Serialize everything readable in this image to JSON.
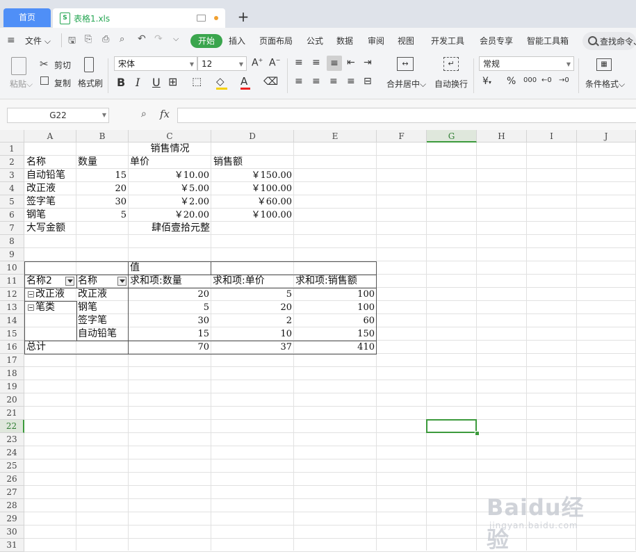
{
  "tabs": {
    "home": "首页",
    "file": "表格1.xls",
    "add": "+"
  },
  "menu": {
    "file": "文件",
    "items": [
      "开始",
      "插入",
      "页面布局",
      "公式",
      "数据",
      "审阅",
      "视图",
      "开发工具",
      "会员专享",
      "智能工具箱"
    ],
    "search_placeholder": "查找命令、"
  },
  "ribbon": {
    "paste": "粘贴",
    "cut": "剪切",
    "copy": "复制",
    "format_painter": "格式刷",
    "font_name": "宋体",
    "font_size": "12",
    "merge_center": "合并居中",
    "wrap_text": "自动换行",
    "number_format": "常规",
    "conditional_format": "条件格式",
    "currency_symbol": "¥",
    "percent_symbol": "%",
    "thousands": "000"
  },
  "formula_bar": {
    "cell_ref": "G22",
    "fx": "fx",
    "value": ""
  },
  "columns": [
    "A",
    "B",
    "C",
    "D",
    "E",
    "F",
    "G",
    "H",
    "I",
    "J"
  ],
  "selected_column": "G",
  "selected_row": 22,
  "rows": [
    1,
    2,
    3,
    4,
    5,
    6,
    7,
    8,
    9,
    10,
    11,
    12,
    13,
    14,
    15,
    16,
    17,
    18,
    19,
    20,
    21,
    22,
    23,
    24,
    25,
    26,
    27,
    28,
    29,
    30,
    31
  ],
  "sheet": {
    "title": "销售情况",
    "headers": [
      "名称",
      "数量",
      "单价",
      "销售额"
    ],
    "records": [
      {
        "name": "自动铅笔",
        "qty": "15",
        "price": "￥10.00",
        "amount": "￥150.00"
      },
      {
        "name": "改正液",
        "qty": "20",
        "price": "￥5.00",
        "amount": "￥100.00"
      },
      {
        "name": "签字笔",
        "qty": "30",
        "price": "￥2.00",
        "amount": "￥60.00"
      },
      {
        "name": "钢笔",
        "qty": "5",
        "price": "￥20.00",
        "amount": "￥100.00"
      }
    ],
    "total_label": "大写金额",
    "total_text": "肆佰壹拾元整"
  },
  "pivot": {
    "values_label": "值",
    "headers": [
      "名称2",
      "名称",
      "求和项:数量",
      "求和项:单价",
      "求和项:销售额"
    ],
    "groups": [
      {
        "group": "改正液",
        "rows": [
          {
            "name": "改正液",
            "qty": "20",
            "price": "5",
            "amount": "100"
          }
        ]
      },
      {
        "group": "笔类",
        "rows": [
          {
            "name": "钢笔",
            "qty": "5",
            "price": "20",
            "amount": "100"
          },
          {
            "name": "签字笔",
            "qty": "30",
            "price": "2",
            "amount": "60"
          },
          {
            "name": "自动铅笔",
            "qty": "15",
            "price": "10",
            "amount": "150"
          }
        ]
      }
    ],
    "grand_total": {
      "label": "总计",
      "qty": "70",
      "price": "37",
      "amount": "410"
    }
  },
  "watermark": {
    "logo": "Baidu经验",
    "url": "jingyan.baidu.com"
  }
}
